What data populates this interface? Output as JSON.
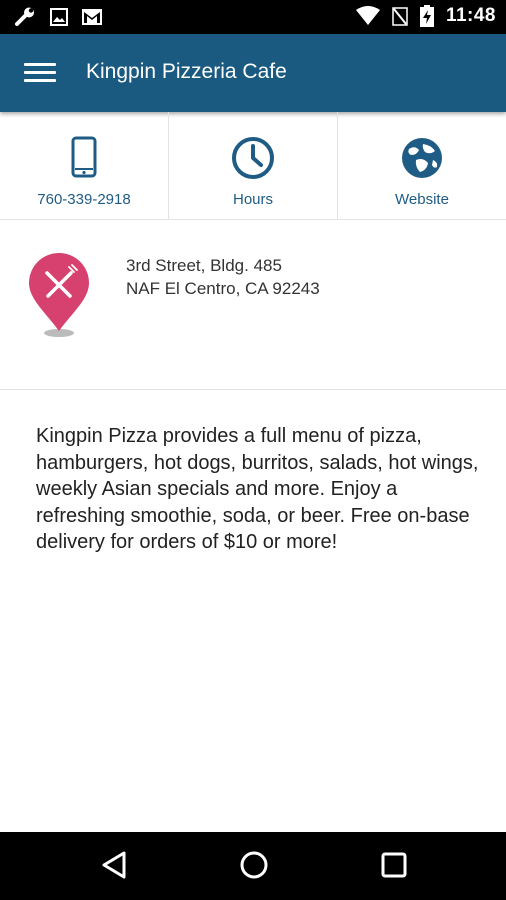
{
  "status_bar": {
    "time": "11:48",
    "left_icons": [
      "wrench-icon",
      "image-icon",
      "gmail-icon"
    ],
    "right_icons": [
      "wifi-icon",
      "signal-off-icon",
      "battery-charging-icon"
    ]
  },
  "app_bar": {
    "title": "Kingpin Pizzeria Cafe",
    "background_color": "#1a5a80"
  },
  "actions": [
    {
      "label": "760-339-2918",
      "icon": "phone-icon"
    },
    {
      "label": "Hours",
      "icon": "clock-icon"
    },
    {
      "label": "Website",
      "icon": "globe-icon"
    }
  ],
  "location": {
    "icon": "restaurant-pin-icon",
    "pin_color": "#d6416f",
    "address_line1": "3rd Street, Bldg. 485",
    "address_line2": "NAF El Centro, CA 92243"
  },
  "description": "Kingpin Pizza provides a full menu of pizza, hamburgers, hot dogs, burritos, salads, hot wings, weekly Asian specials and more. Enjoy a refreshing smoothie, soda, or beer. Free on-base delivery for orders of $10 or more!",
  "nav_bar": {
    "buttons": [
      "back-icon",
      "home-icon",
      "recents-icon"
    ]
  }
}
